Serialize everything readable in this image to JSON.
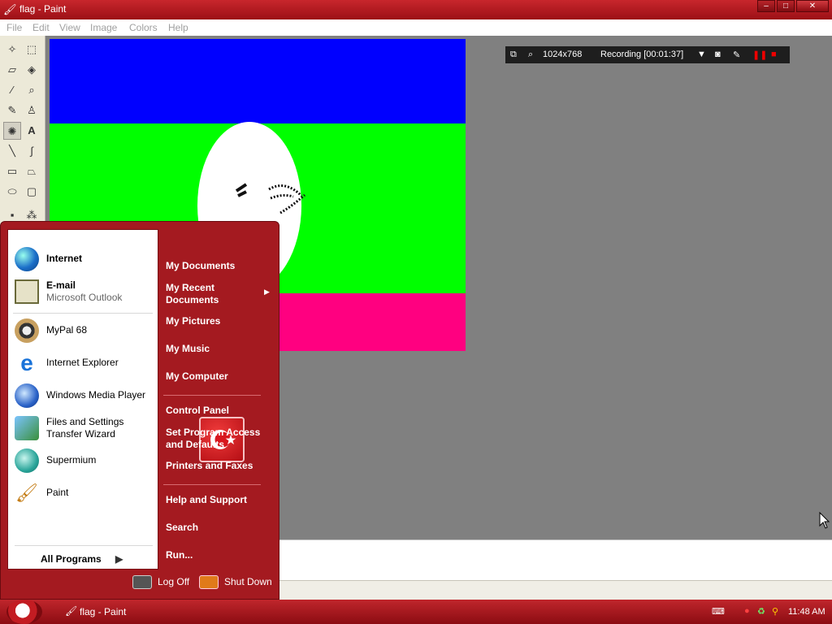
{
  "window": {
    "title": "flag - Paint",
    "controls": {
      "minimize": "–",
      "maximize": "□",
      "close": "✕"
    }
  },
  "menu": [
    "File",
    "Edit",
    "View",
    "Image",
    "Colors",
    "Help"
  ],
  "canvas": {
    "colors": {
      "blue": "#0000ff",
      "green": "#00ff00",
      "pink": "#ff0080",
      "white": "#ffffff"
    }
  },
  "recording_bar": {
    "resolution": "1024x768",
    "status": "Recording [00:01:37]"
  },
  "start_menu": {
    "pinned": [
      {
        "label": "Internet",
        "bold": true,
        "sub": ""
      },
      {
        "label": "E-mail",
        "bold": true,
        "sub": "Microsoft Outlook"
      }
    ],
    "recent": [
      {
        "label": "MyPal 68"
      },
      {
        "label": "Internet Explorer"
      },
      {
        "label": "Windows Media Player"
      },
      {
        "label": "Files and Settings",
        "label2": "Transfer Wizard"
      },
      {
        "label": "Supermium"
      },
      {
        "label": "Paint"
      }
    ],
    "all_programs": "All Programs",
    "right": {
      "my_documents": "My Documents",
      "my_recent_1": "My Recent",
      "my_recent_2": "Documents",
      "my_pictures": "My Pictures",
      "my_music": "My Music",
      "my_computer": "My Computer",
      "control_panel": "Control Panel",
      "set_program_1": "Set Program Access",
      "set_program_2": "and Defaults",
      "printers": "Printers and Faxes",
      "help": "Help and Support",
      "search": "Search",
      "run": "Run..."
    },
    "log_off": "Log Off",
    "shut_down": "Shut Down"
  },
  "taskbar": {
    "task": "flag - Paint",
    "clock": "11:48 AM"
  },
  "colors": {
    "accent": "#a41a20",
    "titlebar": "#c8262c"
  }
}
